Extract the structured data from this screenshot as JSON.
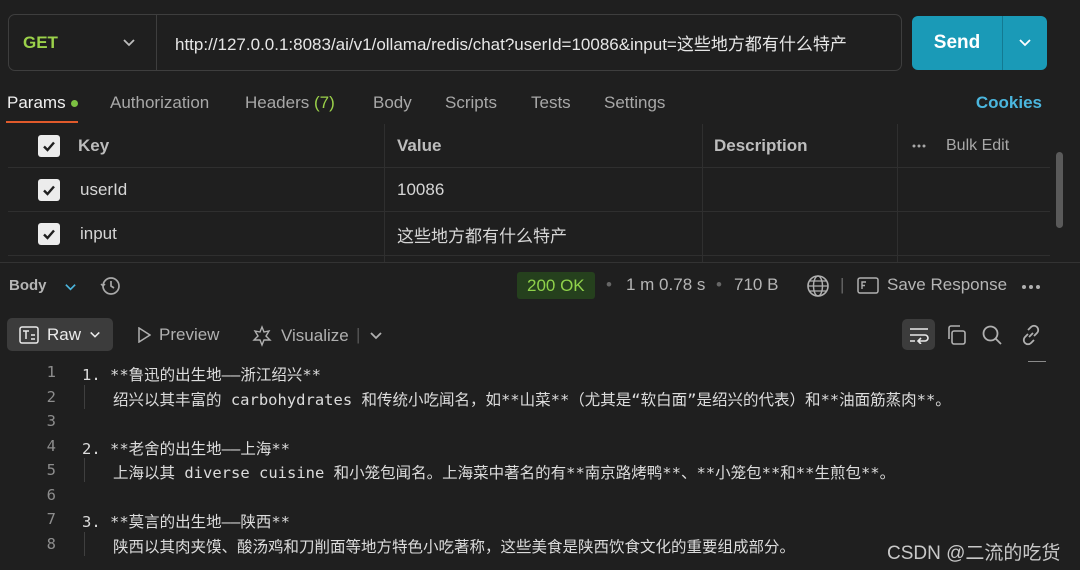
{
  "request": {
    "method": "GET",
    "url": "http://127.0.0.1:8083/ai/v1/ollama/redis/chat?userId=10086&input=这些地方都有什么特产",
    "send_label": "Send"
  },
  "tabs": {
    "params": "Params",
    "authorization": "Authorization",
    "headers": "Headers",
    "headers_count": "(7)",
    "body": "Body",
    "scripts": "Scripts",
    "tests": "Tests",
    "settings": "Settings",
    "cookies": "Cookies"
  },
  "params_table": {
    "headers": {
      "key": "Key",
      "value": "Value",
      "description": "Description",
      "bulk_edit": "Bulk Edit"
    },
    "rows": [
      {
        "key": "userId",
        "value": "10086",
        "checked": true
      },
      {
        "key": "input",
        "value": "这些地方都有什么特产",
        "checked": true
      }
    ]
  },
  "response": {
    "body_label": "Body",
    "status": "200 OK",
    "time": "1 m 0.78 s",
    "size": "710 B",
    "save_response": "Save Response",
    "format": "Raw",
    "preview": "Preview",
    "visualize": "Visualize",
    "lines": [
      {
        "n": "1",
        "text": "1. **鲁迅的出生地——浙江绍兴**"
      },
      {
        "n": "2",
        "text": "绍兴以其丰富的 carbohydrates 和传统小吃闻名，如**山菜**（尤其是“软白面”是绍兴的代表）和**油面筋蒸肉**。"
      },
      {
        "n": "3",
        "text": ""
      },
      {
        "n": "4",
        "text": "2. **老舍的出生地——上海**"
      },
      {
        "n": "5",
        "text": "上海以其 diverse cuisine 和小笼包闻名。上海菜中著名的有**南京路烤鸭**、**小笼包**和**生煎包**。"
      },
      {
        "n": "6",
        "text": ""
      },
      {
        "n": "7",
        "text": "3. **莫言的出生地——陕西**"
      },
      {
        "n": "8",
        "text": "陕西以其肉夹馍、酸汤鸡和刀削面等地方特色小吃著称，这些美食是陕西饮食文化的重要组成部分。"
      }
    ]
  },
  "watermark": "CSDN @二流的吃货",
  "colors": {
    "method": "#9bd14a",
    "send": "#1a9ab7",
    "accent": "#e05a2b",
    "cookies": "#4bb6de",
    "status": "#8fd14a"
  }
}
